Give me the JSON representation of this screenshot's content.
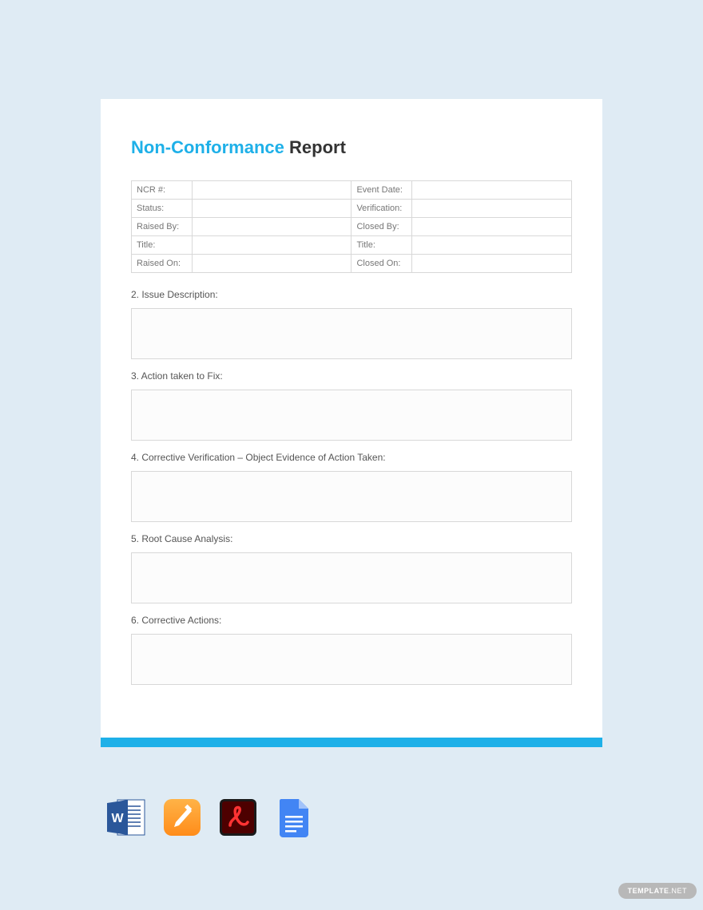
{
  "title": {
    "highlight": "Non-Conformance",
    "rest": " Report"
  },
  "meta": {
    "rows": [
      {
        "l1": "NCR #:",
        "v1": "",
        "l2": "Event Date:",
        "v2": ""
      },
      {
        "l1": "Status:",
        "v1": "",
        "l2": "Verification:",
        "v2": ""
      },
      {
        "l1": "Raised By:",
        "v1": "",
        "l2": "Closed By:",
        "v2": ""
      },
      {
        "l1": "Title:",
        "v1": "",
        "l2": "Title:",
        "v2": ""
      },
      {
        "l1": "Raised On:",
        "v1": "",
        "l2": "Closed On:",
        "v2": ""
      }
    ]
  },
  "sections": {
    "s2": "2. Issue Description:",
    "s3": "3. Action taken to Fix:",
    "s4": "4. Corrective Verification – Object Evidence of Action Taken:",
    "s5": "5. Root Cause Analysis:",
    "s6": "6. Corrective Actions:"
  },
  "watermark": {
    "bold": "TEMPLATE",
    "thin": ".NET"
  }
}
